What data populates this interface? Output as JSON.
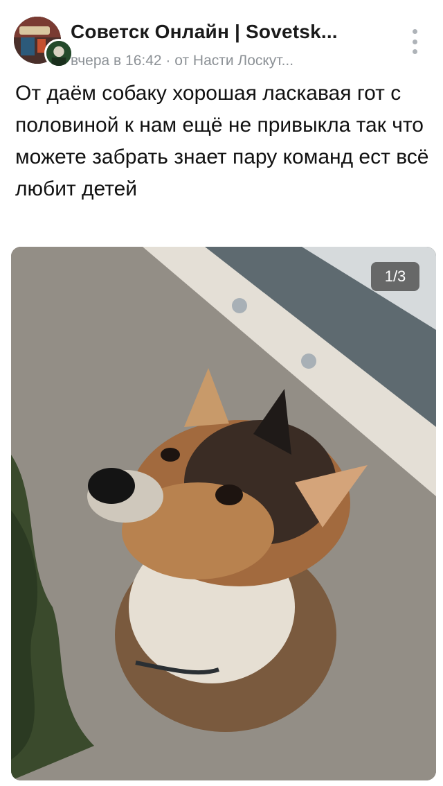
{
  "post": {
    "group_name": "Советск Онлайн | Sovetsk...",
    "meta": "вчера в 16:42 · от Насти Лоскут...",
    "text": "От даём собаку хорошая ласкавая гот с половиной к нам ещё не привыкла так что можете забрать знает пару команд ест всё любит детей",
    "photo": {
      "counter": "1/3",
      "description_icon": "dog-photo"
    }
  },
  "icons": {
    "menu": "vertical-dots-icon",
    "avatar": "group-avatar-icon"
  },
  "colors": {
    "meta_text": "#8c9196",
    "counter_bg": "#3c3c3c",
    "menu_dots": "#aeb3b8"
  }
}
